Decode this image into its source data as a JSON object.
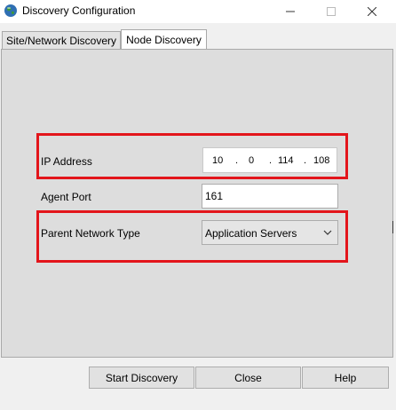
{
  "window": {
    "title": "Discovery Configuration",
    "app_icon": "globe-icon",
    "controls": {
      "minimize": "minimize-icon",
      "maximize": "maximize-icon",
      "close": "close-icon"
    }
  },
  "tabs": [
    {
      "label": "Site/Network Discovery",
      "selected": false
    },
    {
      "label": "Node Discovery",
      "selected": true
    }
  ],
  "form": {
    "ip_address": {
      "label": "IP Address",
      "octets": [
        "10",
        "0",
        "114",
        "108"
      ],
      "separator": "."
    },
    "agent_port": {
      "label": "Agent Port",
      "value": "161"
    },
    "parent_network_type": {
      "label": "Parent Network Type",
      "selected": "Application Servers"
    }
  },
  "buttons": {
    "start": "Start Discovery",
    "close": "Close",
    "help": "Help"
  },
  "colors": {
    "highlight": "#e3151b",
    "panel": "#dddddd",
    "button": "#e1e1e1"
  }
}
